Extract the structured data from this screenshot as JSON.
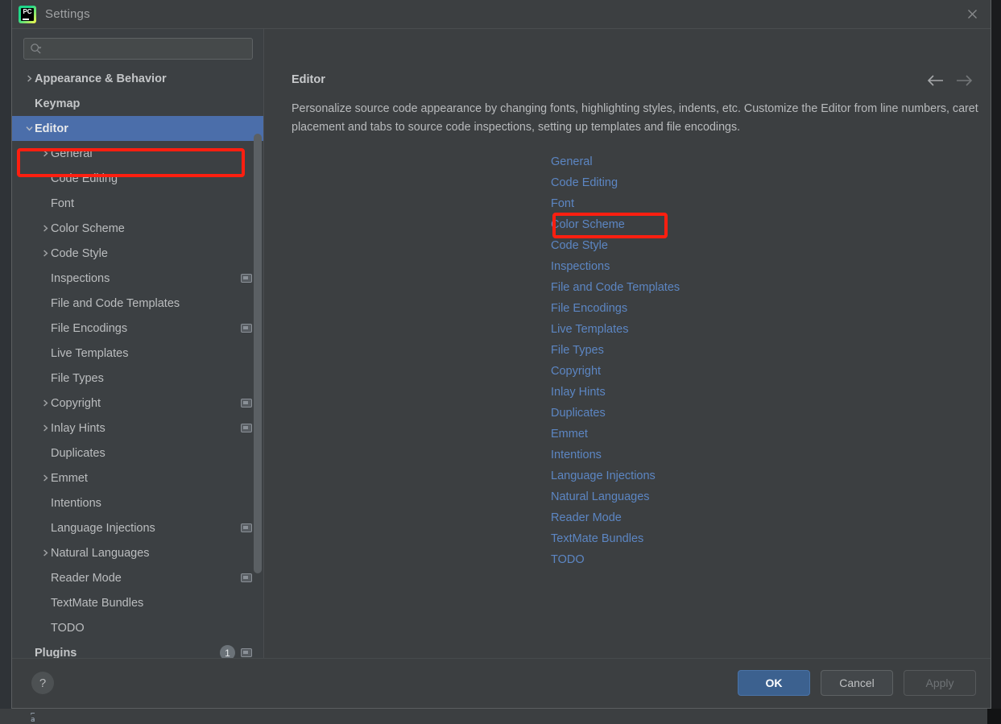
{
  "window": {
    "title": "Settings",
    "logo_icon": "pycharm-logo-icon",
    "logo_text": "PC",
    "close_icon": "close-icon"
  },
  "colors": {
    "dialog_background": "#3c3f41",
    "sidebar_background": "#3c4043",
    "selection_blue": "#4b6eaa",
    "link_blue": "#5c86c3",
    "primary_button": "#3c618f",
    "annotation_red": "#fe1f10",
    "text_primary": "#bbbdbf"
  },
  "search": {
    "placeholder": "",
    "value": "",
    "icon": "search-icon",
    "dropdown_icon": "chevron-down-icon"
  },
  "sidebar": {
    "items": [
      {
        "label": "Appearance & Behavior",
        "depth": 0,
        "bold": true,
        "expandable": true,
        "expanded": false,
        "selected": false,
        "scope_badge": false,
        "count": null
      },
      {
        "label": "Keymap",
        "depth": 0,
        "bold": true,
        "expandable": false,
        "expanded": false,
        "selected": false,
        "scope_badge": false,
        "count": null
      },
      {
        "label": "Editor",
        "depth": 0,
        "bold": true,
        "expandable": true,
        "expanded": true,
        "selected": true,
        "scope_badge": false,
        "count": null
      },
      {
        "label": "General",
        "depth": 1,
        "bold": false,
        "expandable": true,
        "expanded": false,
        "selected": false,
        "scope_badge": false,
        "count": null
      },
      {
        "label": "Code Editing",
        "depth": 1,
        "bold": false,
        "expandable": false,
        "expanded": false,
        "selected": false,
        "scope_badge": false,
        "count": null
      },
      {
        "label": "Font",
        "depth": 1,
        "bold": false,
        "expandable": false,
        "expanded": false,
        "selected": false,
        "scope_badge": false,
        "count": null
      },
      {
        "label": "Color Scheme",
        "depth": 1,
        "bold": false,
        "expandable": true,
        "expanded": false,
        "selected": false,
        "scope_badge": false,
        "count": null
      },
      {
        "label": "Code Style",
        "depth": 1,
        "bold": false,
        "expandable": true,
        "expanded": false,
        "selected": false,
        "scope_badge": false,
        "count": null
      },
      {
        "label": "Inspections",
        "depth": 1,
        "bold": false,
        "expandable": false,
        "expanded": false,
        "selected": false,
        "scope_badge": true,
        "count": null
      },
      {
        "label": "File and Code Templates",
        "depth": 1,
        "bold": false,
        "expandable": false,
        "expanded": false,
        "selected": false,
        "scope_badge": false,
        "count": null
      },
      {
        "label": "File Encodings",
        "depth": 1,
        "bold": false,
        "expandable": false,
        "expanded": false,
        "selected": false,
        "scope_badge": true,
        "count": null
      },
      {
        "label": "Live Templates",
        "depth": 1,
        "bold": false,
        "expandable": false,
        "expanded": false,
        "selected": false,
        "scope_badge": false,
        "count": null
      },
      {
        "label": "File Types",
        "depth": 1,
        "bold": false,
        "expandable": false,
        "expanded": false,
        "selected": false,
        "scope_badge": false,
        "count": null
      },
      {
        "label": "Copyright",
        "depth": 1,
        "bold": false,
        "expandable": true,
        "expanded": false,
        "selected": false,
        "scope_badge": true,
        "count": null
      },
      {
        "label": "Inlay Hints",
        "depth": 1,
        "bold": false,
        "expandable": true,
        "expanded": false,
        "selected": false,
        "scope_badge": true,
        "count": null
      },
      {
        "label": "Duplicates",
        "depth": 1,
        "bold": false,
        "expandable": false,
        "expanded": false,
        "selected": false,
        "scope_badge": false,
        "count": null
      },
      {
        "label": "Emmet",
        "depth": 1,
        "bold": false,
        "expandable": true,
        "expanded": false,
        "selected": false,
        "scope_badge": false,
        "count": null
      },
      {
        "label": "Intentions",
        "depth": 1,
        "bold": false,
        "expandable": false,
        "expanded": false,
        "selected": false,
        "scope_badge": false,
        "count": null
      },
      {
        "label": "Language Injections",
        "depth": 1,
        "bold": false,
        "expandable": false,
        "expanded": false,
        "selected": false,
        "scope_badge": true,
        "count": null
      },
      {
        "label": "Natural Languages",
        "depth": 1,
        "bold": false,
        "expandable": true,
        "expanded": false,
        "selected": false,
        "scope_badge": false,
        "count": null
      },
      {
        "label": "Reader Mode",
        "depth": 1,
        "bold": false,
        "expandable": false,
        "expanded": false,
        "selected": false,
        "scope_badge": true,
        "count": null
      },
      {
        "label": "TextMate Bundles",
        "depth": 1,
        "bold": false,
        "expandable": false,
        "expanded": false,
        "selected": false,
        "scope_badge": false,
        "count": null
      },
      {
        "label": "TODO",
        "depth": 1,
        "bold": false,
        "expandable": false,
        "expanded": false,
        "selected": false,
        "scope_badge": false,
        "count": null
      },
      {
        "label": "Plugins",
        "depth": 0,
        "bold": true,
        "expandable": false,
        "expanded": false,
        "selected": false,
        "scope_badge": true,
        "count": "1"
      }
    ]
  },
  "main": {
    "heading": "Editor",
    "description": "Personalize source code appearance by changing fonts, highlighting styles, indents, etc. Customize the Editor from line numbers, caret placement and tabs to source code inspections, setting up templates and file encodings.",
    "nav": {
      "back_icon": "arrow-left-icon",
      "back_enabled": true,
      "forward_icon": "arrow-right-icon",
      "forward_enabled": false
    },
    "links": [
      "General",
      "Code Editing",
      "Font",
      "Color Scheme",
      "Code Style",
      "Inspections",
      "File and Code Templates",
      "File Encodings",
      "Live Templates",
      "File Types",
      "Copyright",
      "Inlay Hints",
      "Duplicates",
      "Emmet",
      "Intentions",
      "Language Injections",
      "Natural Languages",
      "Reader Mode",
      "TextMate Bundles",
      "TODO"
    ]
  },
  "footer": {
    "help_label": "?",
    "ok_label": "OK",
    "cancel_label": "Cancel",
    "apply_label": "Apply",
    "apply_enabled": false
  },
  "annotations": [
    {
      "target": "Editor",
      "shape": "rectangle",
      "color": "#fe1f10"
    },
    {
      "target": "Color Scheme",
      "shape": "rectangle",
      "color": "#fe1f10"
    }
  ]
}
